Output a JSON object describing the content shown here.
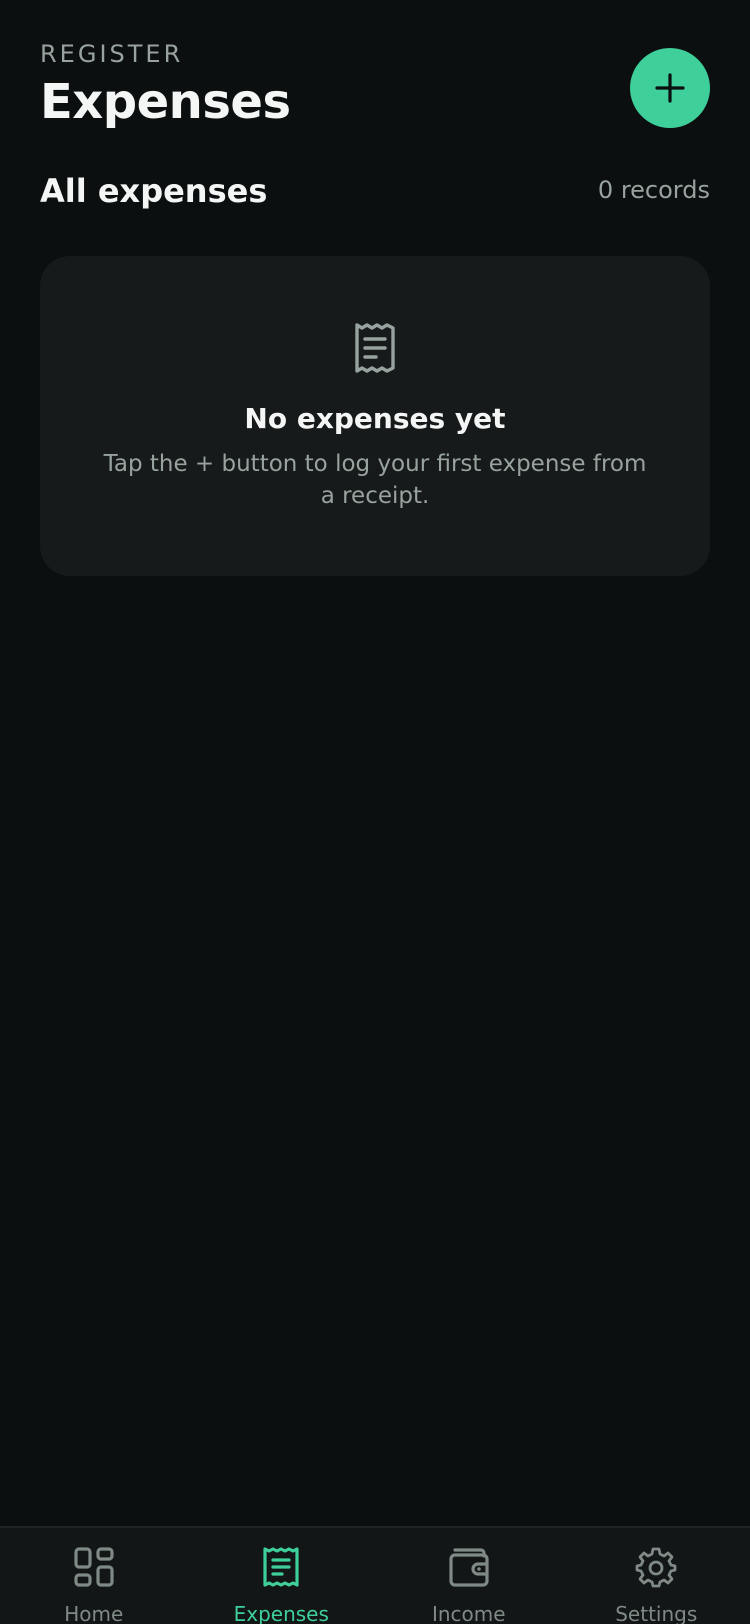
{
  "header": {
    "eyebrow": "REGISTER",
    "title": "Expenses",
    "add_button_icon": "plus-icon"
  },
  "section": {
    "title": "All expenses",
    "records": "0 records"
  },
  "empty_state": {
    "icon": "receipt-icon",
    "title": "No expenses yet",
    "text": "Tap the + button to log your first expense from a receipt."
  },
  "tabbar": {
    "active": "Expenses",
    "items": [
      {
        "label": "Home",
        "icon": "grid-icon"
      },
      {
        "label": "Expenses",
        "icon": "receipt-icon"
      },
      {
        "label": "Income",
        "icon": "wallet-icon"
      },
      {
        "label": "Settings",
        "icon": "gear-icon"
      }
    ]
  },
  "colors": {
    "background": "#0b0f0f",
    "card": "#161a1a",
    "accent": "#3ecf9b",
    "muted_text": "#98a29e"
  }
}
